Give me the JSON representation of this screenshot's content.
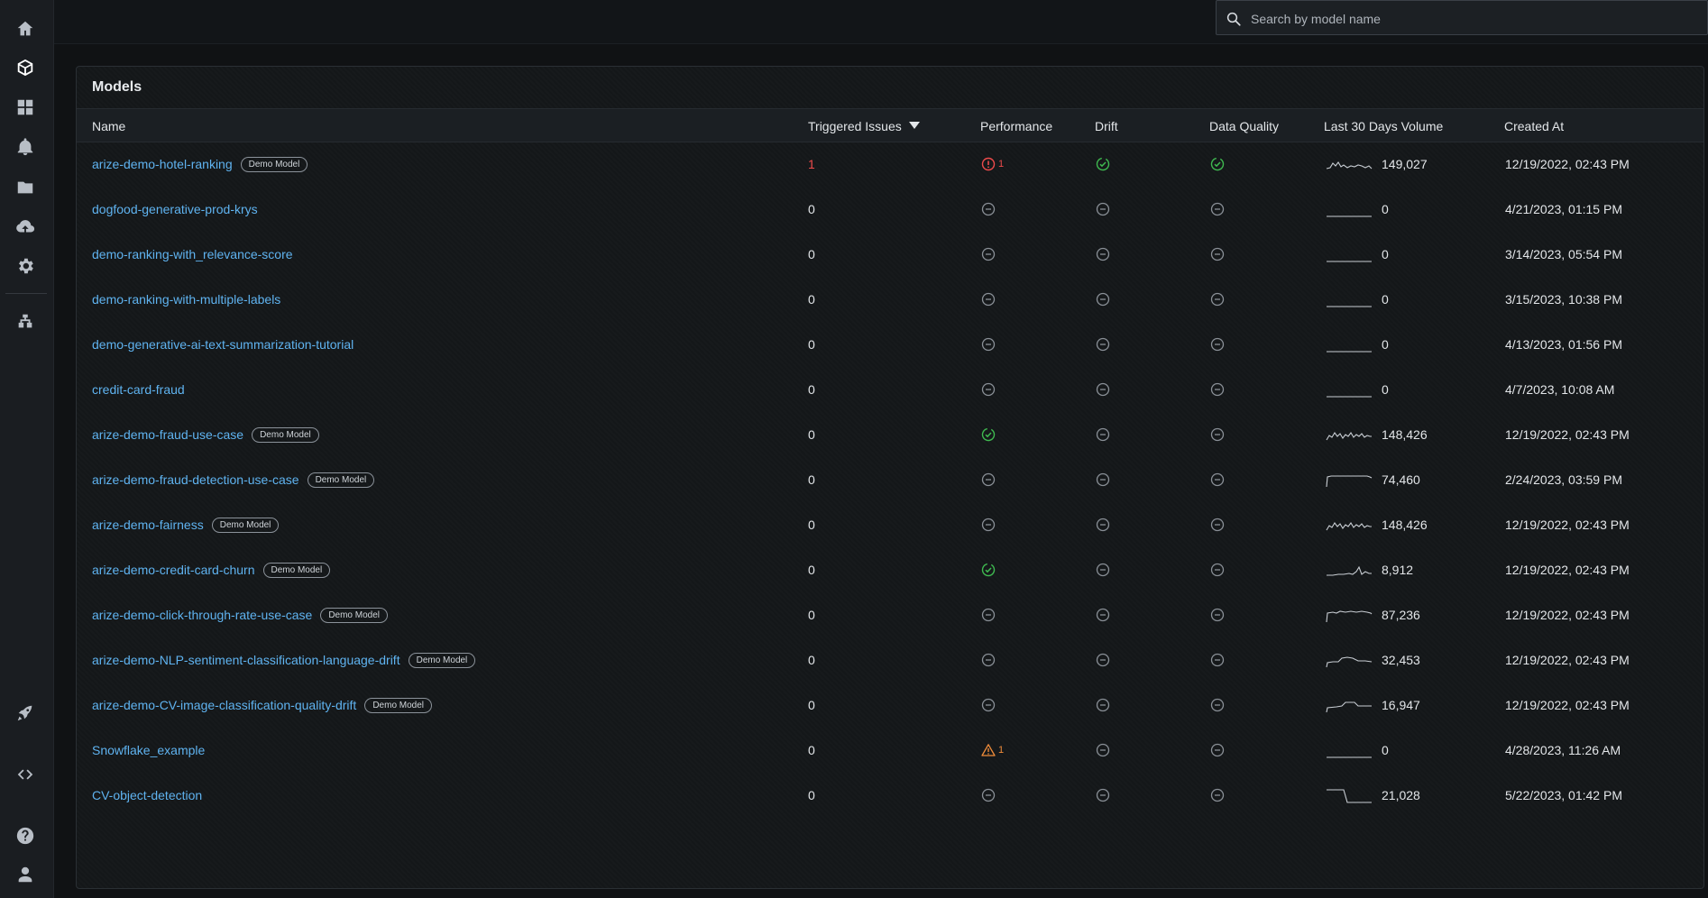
{
  "search": {
    "placeholder": "Search by model name"
  },
  "panel": {
    "title": "Models"
  },
  "columns": {
    "name": "Name",
    "triggered_issues": "Triggered Issues",
    "performance": "Performance",
    "drift": "Drift",
    "data_quality": "Data Quality",
    "volume": "Last 30 Days Volume",
    "created_at": "Created At"
  },
  "sidebar": {
    "items": [
      {
        "icon": "home-icon"
      },
      {
        "icon": "models-cube-icon"
      },
      {
        "icon": "dashboards-grid-icon"
      },
      {
        "icon": "bell-icon"
      },
      {
        "icon": "folder-icon"
      },
      {
        "icon": "cloud-upload-icon"
      },
      {
        "icon": "settings-gear-icon"
      },
      {
        "icon": "integrations-icon"
      },
      {
        "icon": "rocket-icon"
      },
      {
        "icon": "code-icon"
      },
      {
        "icon": "help-icon"
      },
      {
        "icon": "user-icon"
      }
    ]
  },
  "colors": {
    "link": "#5fb3f0",
    "ok": "#3fb950",
    "error": "#ef4b4b",
    "warning": "#f08c3a",
    "neutral": "#8a9097"
  },
  "badge_label": "Demo Model",
  "rows": [
    {
      "name": "arize-demo-hotel-ranking",
      "demo": true,
      "issues": "1",
      "issues_red": true,
      "performance": "error",
      "performance_count": "1",
      "drift": "ok",
      "data_quality": "ok",
      "spark": "mixed",
      "volume": "149,027",
      "created": "12/19/2022, 02:43 PM"
    },
    {
      "name": "dogfood-generative-prod-krys",
      "demo": false,
      "issues": "0",
      "performance": "none",
      "drift": "none",
      "data_quality": "none",
      "spark": "flat",
      "volume": "0",
      "created": "4/21/2023, 01:15 PM"
    },
    {
      "name": "demo-ranking-with_relevance-score",
      "demo": false,
      "issues": "0",
      "performance": "none",
      "drift": "none",
      "data_quality": "none",
      "spark": "flat",
      "volume": "0",
      "created": "3/14/2023, 05:54 PM"
    },
    {
      "name": "demo-ranking-with-multiple-labels",
      "demo": false,
      "issues": "0",
      "performance": "none",
      "drift": "none",
      "data_quality": "none",
      "spark": "flat",
      "volume": "0",
      "created": "3/15/2023, 10:38 PM"
    },
    {
      "name": "demo-generative-ai-text-summarization-tutorial",
      "demo": false,
      "issues": "0",
      "performance": "none",
      "drift": "none",
      "data_quality": "none",
      "spark": "flat",
      "volume": "0",
      "created": "4/13/2023, 01:56 PM"
    },
    {
      "name": "credit-card-fraud",
      "demo": false,
      "issues": "0",
      "performance": "none",
      "drift": "none",
      "data_quality": "none",
      "spark": "flat",
      "volume": "0",
      "created": "4/7/2023, 10:08 AM"
    },
    {
      "name": "arize-demo-fraud-use-case",
      "demo": true,
      "issues": "0",
      "performance": "ok",
      "drift": "none",
      "data_quality": "none",
      "spark": "jagged",
      "volume": "148,426",
      "created": "12/19/2022, 02:43 PM"
    },
    {
      "name": "arize-demo-fraud-detection-use-case",
      "demo": true,
      "issues": "0",
      "performance": "none",
      "drift": "none",
      "data_quality": "none",
      "spark": "plateau",
      "volume": "74,460",
      "created": "2/24/2023, 03:59 PM"
    },
    {
      "name": "arize-demo-fairness",
      "demo": true,
      "issues": "0",
      "performance": "none",
      "drift": "none",
      "data_quality": "none",
      "spark": "jagged",
      "volume": "148,426",
      "created": "12/19/2022, 02:43 PM"
    },
    {
      "name": "arize-demo-credit-card-churn",
      "demo": true,
      "issues": "0",
      "performance": "ok",
      "drift": "none",
      "data_quality": "none",
      "spark": "spike",
      "volume": "8,912",
      "created": "12/19/2022, 02:43 PM"
    },
    {
      "name": "arize-demo-click-through-rate-use-case",
      "demo": true,
      "issues": "0",
      "performance": "none",
      "drift": "none",
      "data_quality": "none",
      "spark": "plateau-noisy",
      "volume": "87,236",
      "created": "12/19/2022, 02:43 PM"
    },
    {
      "name": "arize-demo-NLP-sentiment-classification-language-drift",
      "demo": true,
      "issues": "0",
      "performance": "none",
      "drift": "none",
      "data_quality": "none",
      "spark": "hump",
      "volume": "32,453",
      "created": "12/19/2022, 02:43 PM"
    },
    {
      "name": "arize-demo-CV-image-classification-quality-drift",
      "demo": true,
      "issues": "0",
      "performance": "none",
      "drift": "none",
      "data_quality": "none",
      "spark": "hump2",
      "volume": "16,947",
      "created": "12/19/2022, 02:43 PM"
    },
    {
      "name": "Snowflake_example",
      "demo": false,
      "issues": "0",
      "performance": "warning",
      "performance_count": "1",
      "drift": "none",
      "data_quality": "none",
      "spark": "flat",
      "volume": "0",
      "created": "4/28/2023, 11:26 AM"
    },
    {
      "name": "CV-object-detection",
      "demo": false,
      "issues": "0",
      "performance": "none",
      "drift": "none",
      "data_quality": "none",
      "spark": "step",
      "volume": "21,028",
      "created": "5/22/2023, 01:42 PM"
    }
  ]
}
